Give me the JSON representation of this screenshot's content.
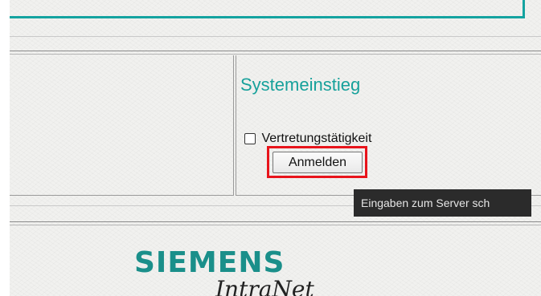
{
  "login": {
    "title": "Systemeinstieg",
    "checkbox_label": "Vertretungstätigkeit",
    "checkbox_checked": false,
    "submit_label": "Anmelden",
    "tooltip": "Eingaben zum Server sch"
  },
  "footer": {
    "brand": "SIEMENS",
    "product": "IntraNet"
  },
  "colors": {
    "accent": "#14a3a0",
    "highlight": "#e8141b",
    "tooltip_bg": "#2b2b2b"
  }
}
